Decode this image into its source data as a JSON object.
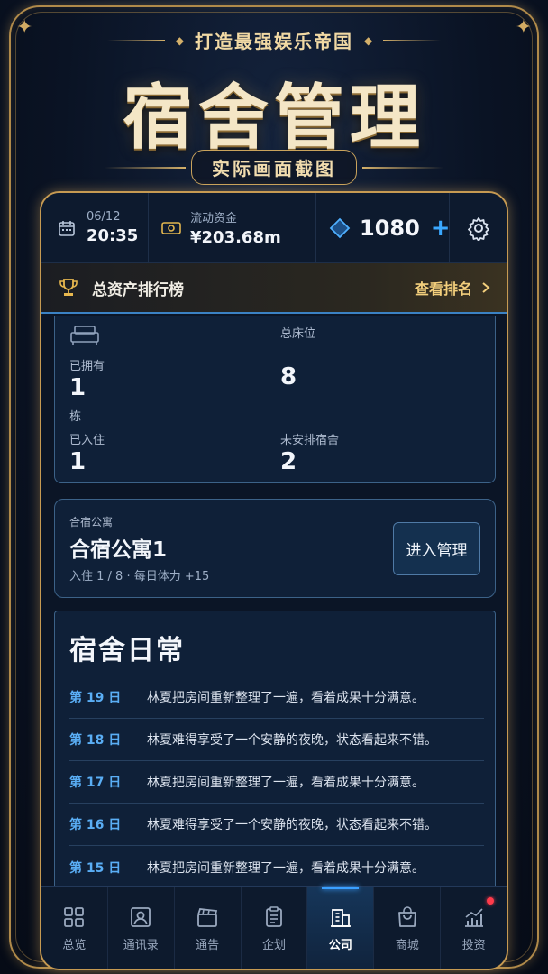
{
  "banner": {
    "slogan": "打造最强娱乐帝国",
    "title": "宿舍管理",
    "subtitle": "实际画面截图"
  },
  "topbar": {
    "date": "06/12",
    "time": "20:35",
    "money_label": "流动资金",
    "money_value": "¥203.68m",
    "gems": "1080",
    "plus": "+"
  },
  "rank": {
    "title": "总资产排行榜",
    "link": "查看排名"
  },
  "stats": {
    "total_beds_label": "总床位",
    "owned_label": "已拥有",
    "owned_value": "1",
    "owned_unit": "栋",
    "beds_value": "8",
    "resident_label": "已入住",
    "resident_value": "1",
    "unassigned_label": "未安排宿舍",
    "unassigned_value": "2"
  },
  "dorm": {
    "category": "合宿公寓",
    "name": "合宿公寓1",
    "meta": "入住 1 / 8 · 每日体力 +15",
    "button": "进入管理"
  },
  "daily": {
    "title": "宿舍日常",
    "logs": [
      {
        "day": "第 19 日",
        "text": "林夏把房间重新整理了一遍，看着成果十分满意。"
      },
      {
        "day": "第 18 日",
        "text": "林夏难得享受了一个安静的夜晚，状态看起来不错。"
      },
      {
        "day": "第 17 日",
        "text": "林夏把房间重新整理了一遍，看着成果十分满意。"
      },
      {
        "day": "第 16 日",
        "text": "林夏难得享受了一个安静的夜晚，状态看起来不错。"
      },
      {
        "day": "第 15 日",
        "text": "林夏把房间重新整理了一遍，看着成果十分满意。"
      }
    ]
  },
  "tabs": [
    {
      "label": "总览",
      "icon": "grid-icon"
    },
    {
      "label": "通讯录",
      "icon": "contacts-icon"
    },
    {
      "label": "通告",
      "icon": "clapper-icon"
    },
    {
      "label": "企划",
      "icon": "clipboard-icon"
    },
    {
      "label": "公司",
      "icon": "building-icon",
      "active": true
    },
    {
      "label": "商城",
      "icon": "shopping-bag-icon"
    },
    {
      "label": "投资",
      "icon": "chart-icon",
      "badge": true
    }
  ],
  "colors": {
    "gold": "#c69a52",
    "accent_blue": "#3aa0ff",
    "day_blue": "#5aaef5",
    "badge_red": "#ff3b4b"
  }
}
